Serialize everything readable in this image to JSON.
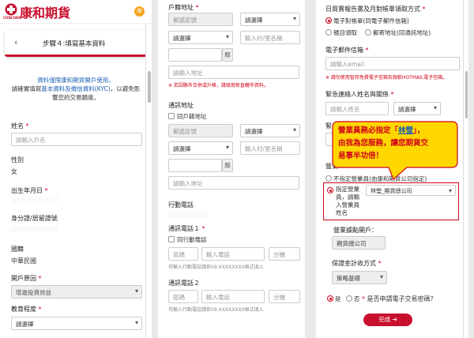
{
  "app": {
    "logo_text": "康和期貨",
    "logo_sub": "CONCORD",
    "brand_color": "#c8102e",
    "accent_color": "#f5a623"
  },
  "p1": {
    "step_title": "步驟４:填寫基本資料",
    "notice_line1": "資料僅限康和期貨開戶使用，",
    "notice_line2a": "請確實填寫",
    "notice_line2b": "基本資料及徵信資料(KYC)",
    "notice_line2c": "，以避免影",
    "notice_line3": "響您的交易額度。",
    "name_label": "姓名",
    "name_placeholder": "請輸入戶名",
    "gender_label": "性別",
    "gender_value": "女",
    "dob_label": "出生年月日",
    "id_label": "身分證/居留證號",
    "nationality_label": "國籍",
    "nationality_value": "中華民國",
    "purpose_label": "開戶原因",
    "purpose_value": "增進投資效益",
    "edu_label": "教育程度",
    "edu_value": "請選擇"
  },
  "p2": {
    "residence_label": "戶籍地址",
    "postal_placeholder": "郵遞區號",
    "select_placeholder": "請選擇",
    "village_placeholder": "輸入村/里名稱",
    "neighborhood_suffix": "鄰",
    "address_placeholder": "請輸入地址",
    "residence_hint": "※ 若因縣市合併或升格，請填寫新直轄市資料。",
    "mail_label": "通訊地址",
    "same_as_residence": "同戶籍地址",
    "mobile_label": "行動電話",
    "phone1_label": "通訊電話１",
    "same_as_mobile": "同行動電話",
    "area_code_placeholder": "區碼",
    "phone_placeholder": "輸入電話",
    "ext_placeholder": "分機",
    "mobile_hint": "可輸入行動電話",
    "format_hint": "請依09-XXXXXXXX格式填入",
    "phone2_label": "通訊電話２"
  },
  "p3": {
    "statement_label": "日買賣報告書及月對帳單領取方式",
    "option_email": "電子對帳單(同電子郵件信箱)",
    "option_pickup": "親自領取",
    "option_mail": "郵寄地址(同通訊地址)",
    "email_label": "電子郵件信箱",
    "email_placeholder": "請輸入email",
    "email_hint": "※ 請勿使用智邦免費電子信箱及微軟HOTMAIL電子信箱。",
    "emergency_label": "緊急連絡人姓名與關係",
    "emergency_name_placeholder": "請輸入姓名",
    "select_placeholder": "請選擇",
    "emergency_phone_label": "緊急",
    "salesperson_label": "營業",
    "option_no_salesperson": "不指定營業員(由康和期貨公司指定)",
    "assign_label_lines": [
      "指定營業",
      "員，請輸",
      "入營業員",
      "姓名"
    ],
    "assign_value": "林瑩_期貨總公司",
    "branch_label": "營業據點開戶：",
    "branch_value": "期貨總公司",
    "guarantee_label": "保證金計收方式",
    "guarantee_value": "策略基礎",
    "yes": "是",
    "no": "否",
    "password_question": "是否申請電子交易密碼？",
    "finish_button": "完成",
    "callout_line1a": "營業員務必指定「",
    "callout_name": "林瑩",
    "callout_line1b": "」，",
    "callout_line2": "由我為您服務，讓您期貨交",
    "callout_line3": "易事半功倍！",
    "callout_color": "#ffd700"
  }
}
